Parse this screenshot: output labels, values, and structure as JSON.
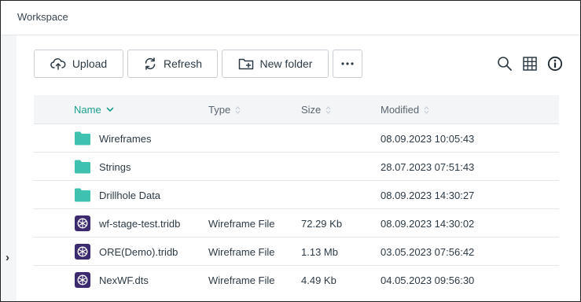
{
  "window": {
    "title": "Workspace"
  },
  "toolbar": {
    "upload_label": "Upload",
    "refresh_label": "Refresh",
    "new_folder_label": "New folder",
    "more_icon": "ellipsis-icon",
    "search_icon": "search-icon",
    "grid_icon": "grid-view-icon",
    "info_icon": "info-icon"
  },
  "table": {
    "columns": {
      "name": "Name",
      "type": "Type",
      "size": "Size",
      "modified": "Modified"
    },
    "sorted_by": "Name",
    "rows": [
      {
        "kind": "folder",
        "name": "Wireframes",
        "type": "",
        "size": "",
        "modified": "08.09.2023 10:05:43"
      },
      {
        "kind": "folder",
        "name": "Strings",
        "type": "",
        "size": "",
        "modified": "28.07.2023 07:51:43"
      },
      {
        "kind": "folder",
        "name": "Drillhole Data",
        "type": "",
        "size": "",
        "modified": "08.09.2023 14:30:27"
      },
      {
        "kind": "file",
        "name": "wf-stage-test.tridb",
        "type": "Wireframe File",
        "size": "72.29 Kb",
        "modified": "08.09.2023 14:30:02"
      },
      {
        "kind": "file",
        "name": "ORE(Demo).tridb",
        "type": "Wireframe File",
        "size": "1.13 Mb",
        "modified": "03.05.2023 07:56:42"
      },
      {
        "kind": "file",
        "name": "NexWF.dts",
        "type": "Wireframe File",
        "size": "4.49 Kb",
        "modified": "04.05.2023 09:56:30"
      }
    ]
  },
  "colors": {
    "accent": "#1a9e8f",
    "folder": "#3fc1b0",
    "file_icon": "#3b2a6e",
    "header_bg": "#f3f5f7"
  },
  "sidebar": {
    "expand_icon": "chevron-right-icon"
  }
}
